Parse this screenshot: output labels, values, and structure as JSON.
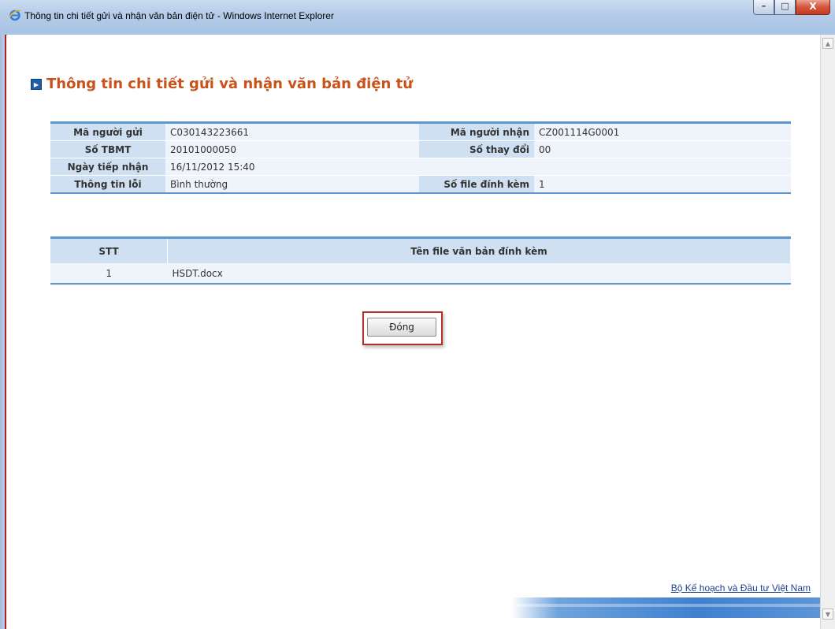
{
  "window": {
    "title": "Thông tin chi tiết gửi và nhận văn bản điện tử - Windows Internet Explorer",
    "controls": {
      "minimize": "–",
      "maximize": "□",
      "close": "X"
    }
  },
  "page": {
    "heading": "Thông tin chi tiết gửi và nhận văn bản điện tử",
    "heading_icon": "play-arrow-icon"
  },
  "info": {
    "sender_label": "Mã người gửi",
    "sender_value": "C030143223661",
    "receiver_label": "Mã người nhận",
    "receiver_value": "CZ001114G0001",
    "tbmt_label": "Số TBMT",
    "tbmt_value": "20101000050",
    "change_label": "Số thay đổi",
    "change_value": "00",
    "received_label": "Ngày tiếp nhận",
    "received_value": "16/11/2012 15:40",
    "error_label": "Thông tin lỗi",
    "error_value": "Bình thường",
    "attach_count_label": "Số file đính kèm",
    "attach_count_value": "1"
  },
  "files": {
    "headers": {
      "stt": "STT",
      "name": "Tên file văn bản đính kèm"
    },
    "rows": [
      {
        "stt": "1",
        "name": "HSDT.docx"
      }
    ]
  },
  "actions": {
    "close_label": "Đóng"
  },
  "footer": {
    "org": "Bộ Kế hoạch và Đầu tư Việt Nam"
  },
  "colors": {
    "heading": "#c8521a",
    "table_header": "#cfe0f2",
    "table_border": "#5e96cf",
    "highlight": "#b72d2d"
  }
}
